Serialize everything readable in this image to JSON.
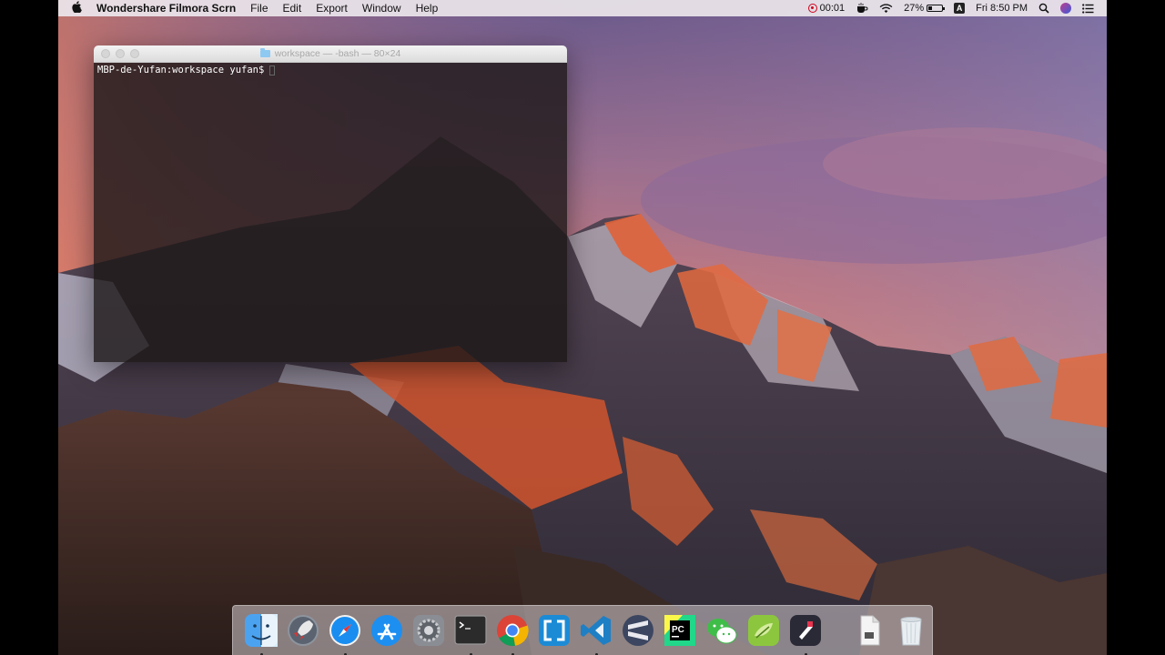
{
  "menubar": {
    "app_name": "Wondershare Filmora Scrn",
    "menus": [
      "File",
      "Edit",
      "Export",
      "Window",
      "Help"
    ],
    "record_time": "00:01",
    "battery_percent": "27%",
    "battery_level": 0.27,
    "input_source": "A",
    "clock": "Fri 8:50 PM"
  },
  "terminal": {
    "title": "workspace — -bash — 80×24",
    "prompt": "MBP-de-Yufan:workspace yufan$"
  },
  "dock": {
    "apps": [
      "finder",
      "launchpad",
      "safari",
      "app-store",
      "system-preferences",
      "terminal",
      "chrome",
      "sourcetree",
      "vscode",
      "sublime",
      "pycharm",
      "wechat",
      "android-file-transfer",
      "filmora-scrn"
    ],
    "running": [
      "finder",
      "safari",
      "terminal",
      "chrome",
      "filmora-scrn"
    ],
    "right": [
      "document-stack",
      "trash"
    ]
  },
  "colors": {
    "menubar_bg": "#ebe6eb",
    "terminal_bg": "#1c1616",
    "record_red": "#d0021b"
  }
}
